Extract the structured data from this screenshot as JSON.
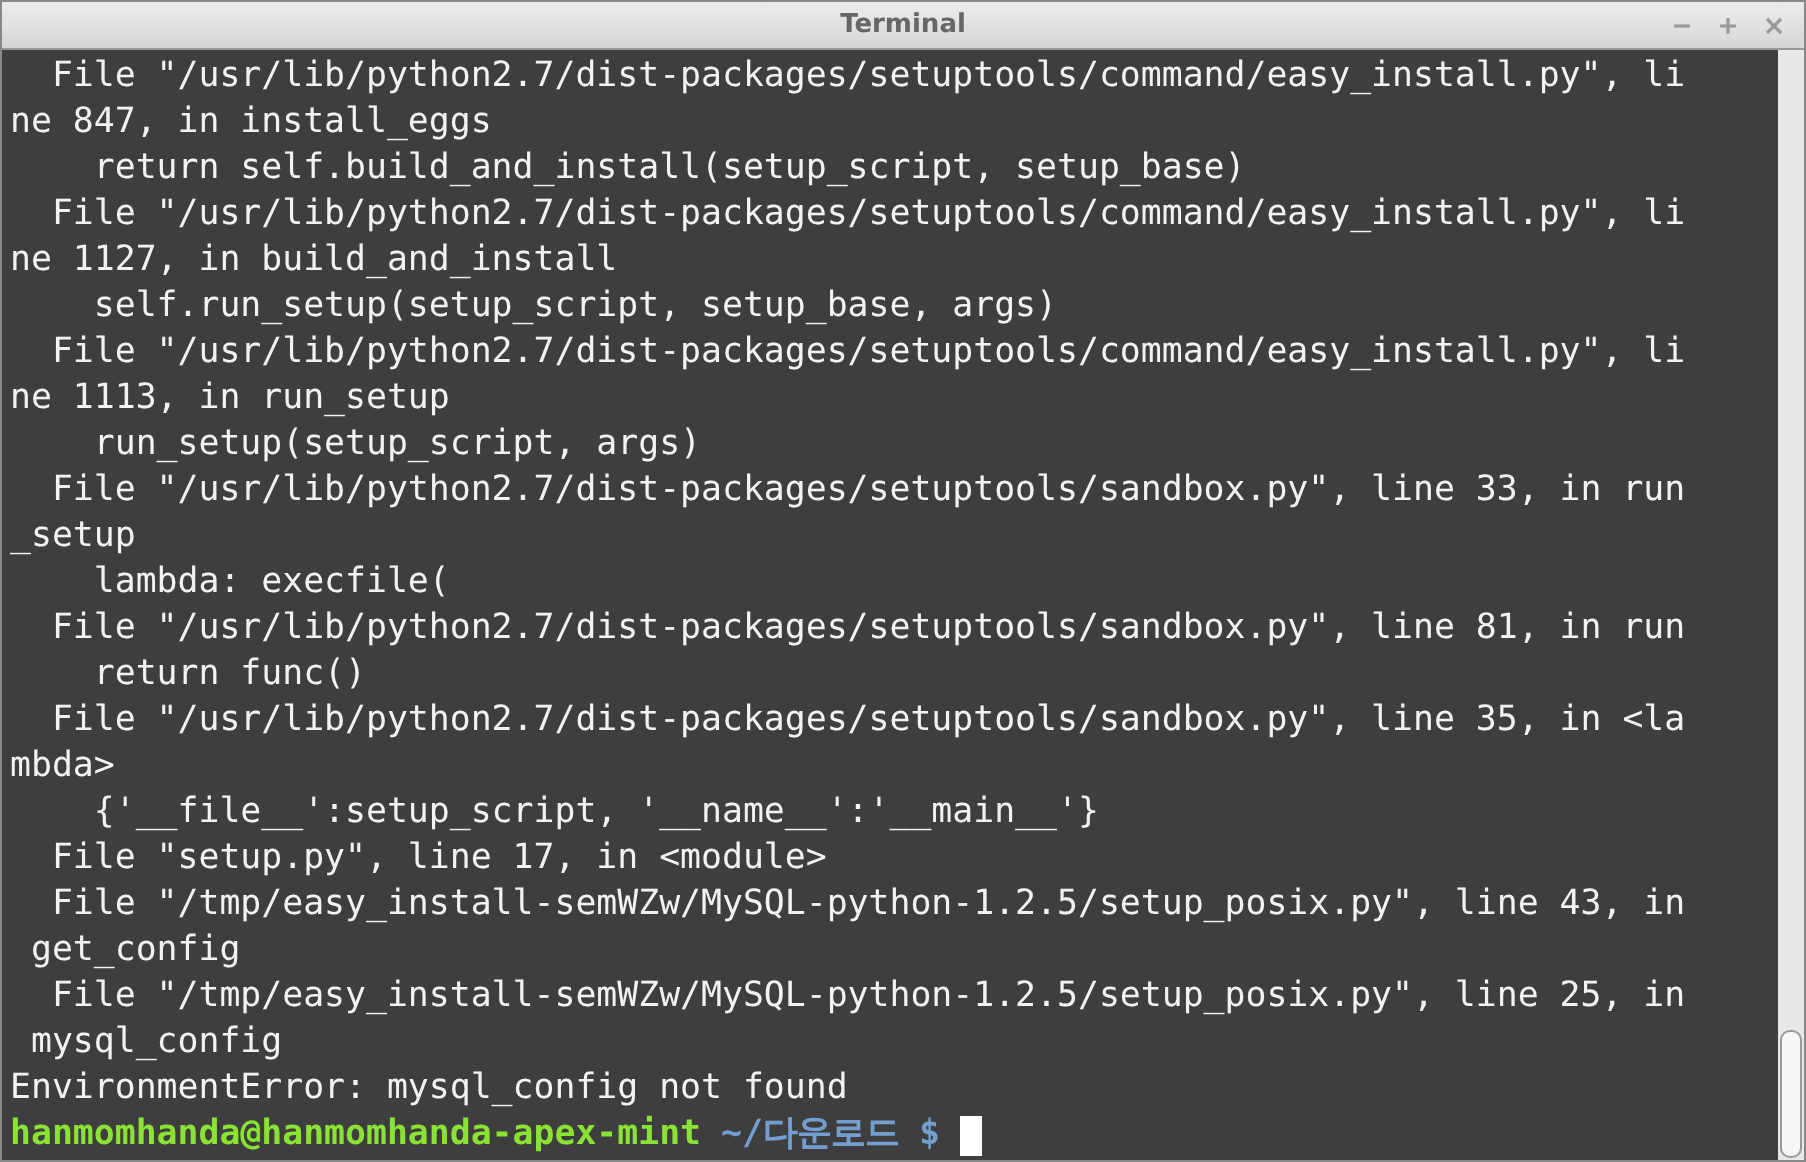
{
  "window": {
    "title": "Terminal"
  },
  "output_lines": [
    "  File \"/usr/lib/python2.7/dist-packages/setuptools/command/easy_install.py\", li",
    "ne 847, in install_eggs",
    "    return self.build_and_install(setup_script, setup_base)",
    "  File \"/usr/lib/python2.7/dist-packages/setuptools/command/easy_install.py\", li",
    "ne 1127, in build_and_install",
    "    self.run_setup(setup_script, setup_base, args)",
    "  File \"/usr/lib/python2.7/dist-packages/setuptools/command/easy_install.py\", li",
    "ne 1113, in run_setup",
    "    run_setup(setup_script, args)",
    "  File \"/usr/lib/python2.7/dist-packages/setuptools/sandbox.py\", line 33, in run",
    "_setup",
    "    lambda: execfile(",
    "  File \"/usr/lib/python2.7/dist-packages/setuptools/sandbox.py\", line 81, in run",
    "    return func()",
    "  File \"/usr/lib/python2.7/dist-packages/setuptools/sandbox.py\", line 35, in <la",
    "mbda>",
    "    {'__file__':setup_script, '__name__':'__main__'}",
    "  File \"setup.py\", line 17, in <module>",
    "  File \"/tmp/easy_install-semWZw/MySQL-python-1.2.5/setup_posix.py\", line 43, in",
    " get_config",
    "  File \"/tmp/easy_install-semWZw/MySQL-python-1.2.5/setup_posix.py\", line 25, in",
    " mysql_config",
    "EnvironmentError: mysql_config not found"
  ],
  "prompt": {
    "user_host": "hanmomhanda@hanmomhanda-apex-mint",
    "path": "~/다운로드",
    "symbol": "$"
  }
}
